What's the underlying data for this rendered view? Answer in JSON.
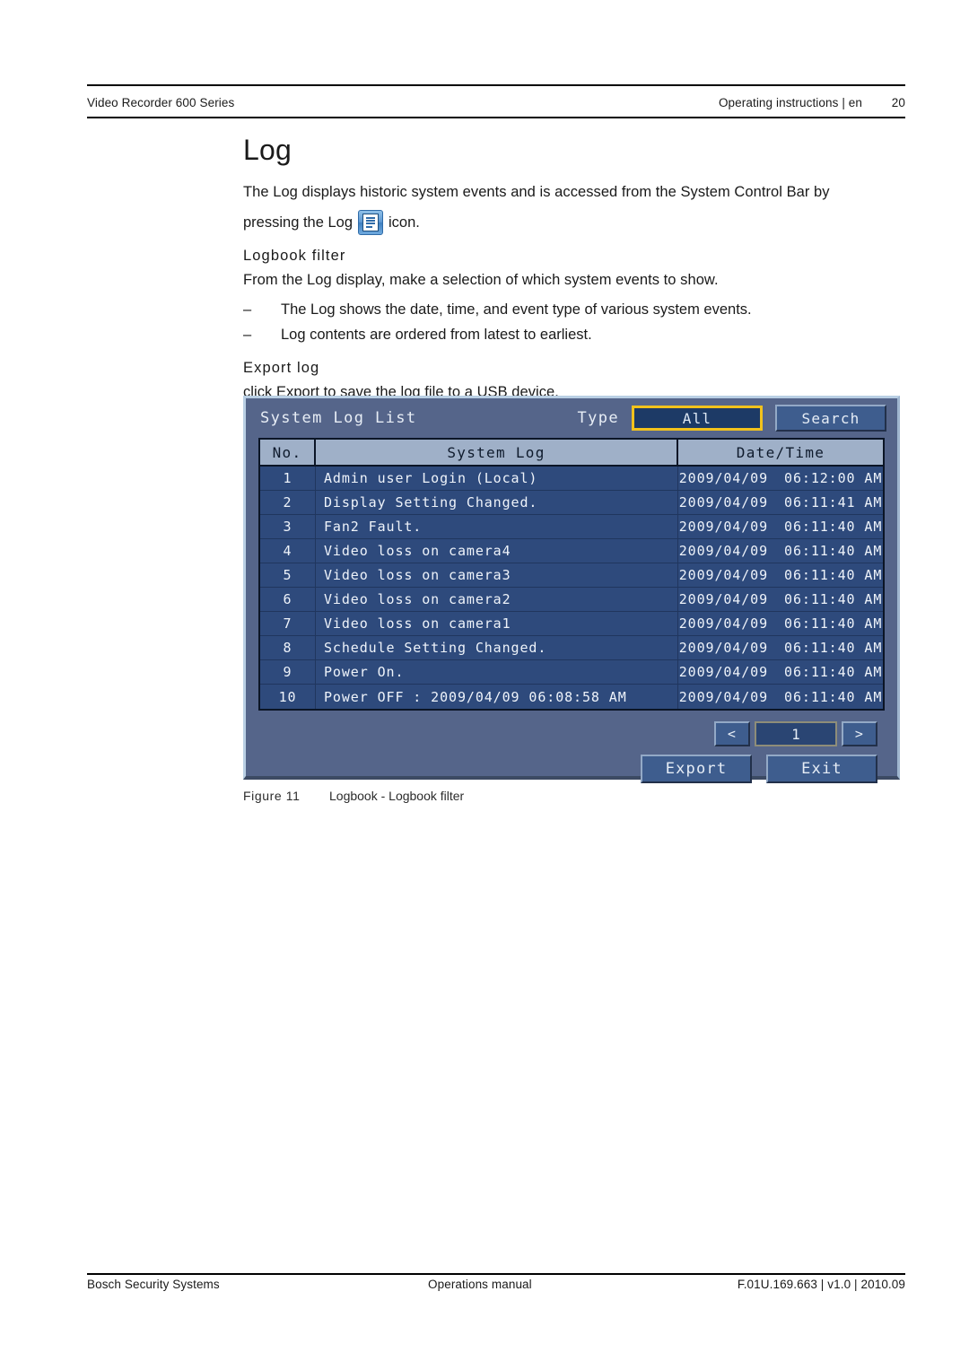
{
  "header": {
    "left": "Video Recorder 600 Series",
    "right": "Operating instructions | en",
    "page_number": "20"
  },
  "main": {
    "title": "Log",
    "intro_line1": "The Log displays historic system events and is accessed from the System Control Bar by",
    "intro_line2_before": "pressing the Log",
    "intro_line2_after": "icon.",
    "log_icon_name": "log-list-icon",
    "subhead_filter": "Logbook filter",
    "filter_intro": "From the Log display, make a selection of which system events to show.",
    "dash": "–",
    "bullets": [
      "The Log shows the date, time, and event type of various system events.",
      "Log contents are ordered from latest to earliest."
    ],
    "subhead_export": "Export log",
    "export_intro": "click Export to save the log file to a USB device."
  },
  "dvr": {
    "title": "System Log List",
    "type_label": "Type",
    "type_value": "All",
    "search_label": "Search",
    "columns": {
      "no": "No.",
      "log": "System Log",
      "datetime": "Date/Time"
    },
    "rows": [
      {
        "no": "1",
        "log": "Admin user Login (Local)",
        "date": "2009/04/09",
        "time": "06:12:00 AM"
      },
      {
        "no": "2",
        "log": "Display Setting Changed.",
        "date": "2009/04/09",
        "time": "06:11:41 AM"
      },
      {
        "no": "3",
        "log": "Fan2 Fault.",
        "date": "2009/04/09",
        "time": "06:11:40 AM"
      },
      {
        "no": "4",
        "log": "Video loss on camera4",
        "date": "2009/04/09",
        "time": "06:11:40 AM"
      },
      {
        "no": "5",
        "log": "Video loss on camera3",
        "date": "2009/04/09",
        "time": "06:11:40 AM"
      },
      {
        "no": "6",
        "log": "Video loss on camera2",
        "date": "2009/04/09",
        "time": "06:11:40 AM"
      },
      {
        "no": "7",
        "log": "Video loss on camera1",
        "date": "2009/04/09",
        "time": "06:11:40 AM"
      },
      {
        "no": "8",
        "log": "Schedule Setting Changed.",
        "date": "2009/04/09",
        "time": "06:11:40 AM"
      },
      {
        "no": "9",
        "log": "Power On.",
        "date": "2009/04/09",
        "time": "06:11:40 AM"
      },
      {
        "no": "10",
        "log": "Power OFF : 2009/04/09   06:08:58 AM",
        "date": "2009/04/09",
        "time": "06:11:40 AM"
      }
    ],
    "pager": {
      "prev": "<",
      "current_page": "1",
      "next": ">"
    },
    "export_label": "Export",
    "exit_label": "Exit",
    "colors": {
      "panel_bg": "#55658a",
      "row_bg": "#2e4a7c",
      "header_bg": "#9fb0c8",
      "highlight_border": "#f2c21c",
      "button_bg": "#3e5d8e"
    }
  },
  "figure": {
    "number": "Figure  11",
    "caption": "Logbook - Logbook filter"
  },
  "footer": {
    "left": "Bosch Security Systems",
    "middle": "Operations manual",
    "right": "F.01U.169.663 | v1.0 | 2010.09"
  }
}
